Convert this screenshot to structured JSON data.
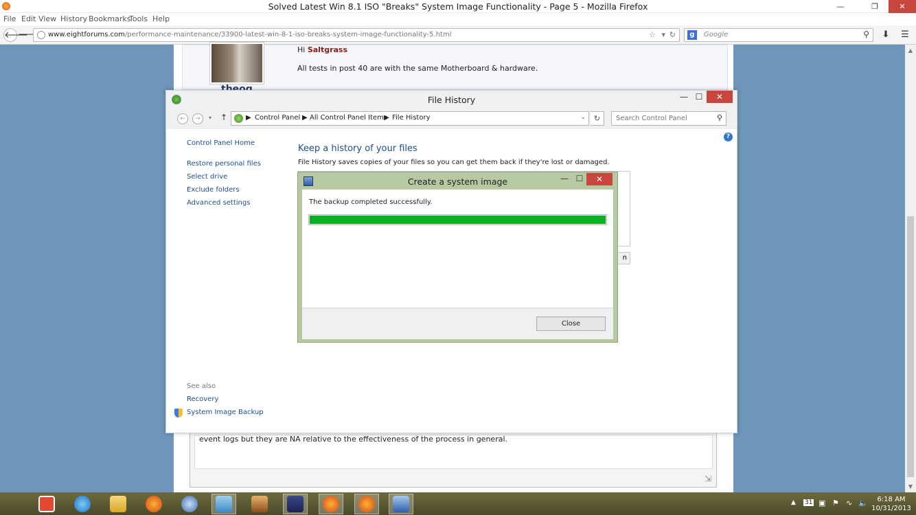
{
  "browser": {
    "title": "Solved Latest Win 8.1 ISO \"Breaks\" System Image Functionality - Page 5 - Mozilla Firefox",
    "menu": [
      "File",
      "Edit",
      "View",
      "History",
      "Bookmarks",
      "Tools",
      "Help"
    ],
    "url_host": "www.eightforums.com",
    "url_path": "/performance-maintenance/33900-latest-win-8-1-iso-breaks-system-image-functionality-5.html",
    "search_engine": "Google",
    "search_placeholder": "Google"
  },
  "webpage": {
    "username": "theog",
    "greeting_prefix": "Hi ",
    "greeting_name": "Saltgrass",
    "post_text": "All tests in post 40 are with the same Motherboard & hardware.",
    "editor_text": "event logs but they are NA relative to the effectiveness of the process in general."
  },
  "file_history": {
    "title": "File History",
    "breadcrumb": [
      "Control Panel",
      "All Control Panel Items",
      "File History"
    ],
    "search_placeholder": "Search Control Panel",
    "nav_links": [
      "Control Panel Home",
      "Restore personal files",
      "Select drive",
      "Exclude folders",
      "Advanced settings"
    ],
    "heading": "Keep a history of your files",
    "description": "File History saves copies of your files so you can get them back if they're lost or damaged.",
    "partial_button": "n",
    "see_also_label": "See also",
    "see_also_links": [
      "Recovery",
      "System Image Backup"
    ]
  },
  "dialog": {
    "title": "Create a system image",
    "message": "The backup completed successfully.",
    "progress_percent": 100,
    "close_label": "Close",
    "accent_color": "#06b025"
  },
  "taskbar": {
    "icons": [
      "start-icon",
      "internet-explorer-icon",
      "file-explorer-icon",
      "firefox-icon",
      "thunderbird-icon",
      "control-panel-icon",
      "app-icon",
      "winamp-icon",
      "firefox-icon",
      "firefox-icon",
      "system-image-icon"
    ],
    "time": "6:18 AM",
    "date": "10/31/2013",
    "tray_number": "31"
  }
}
